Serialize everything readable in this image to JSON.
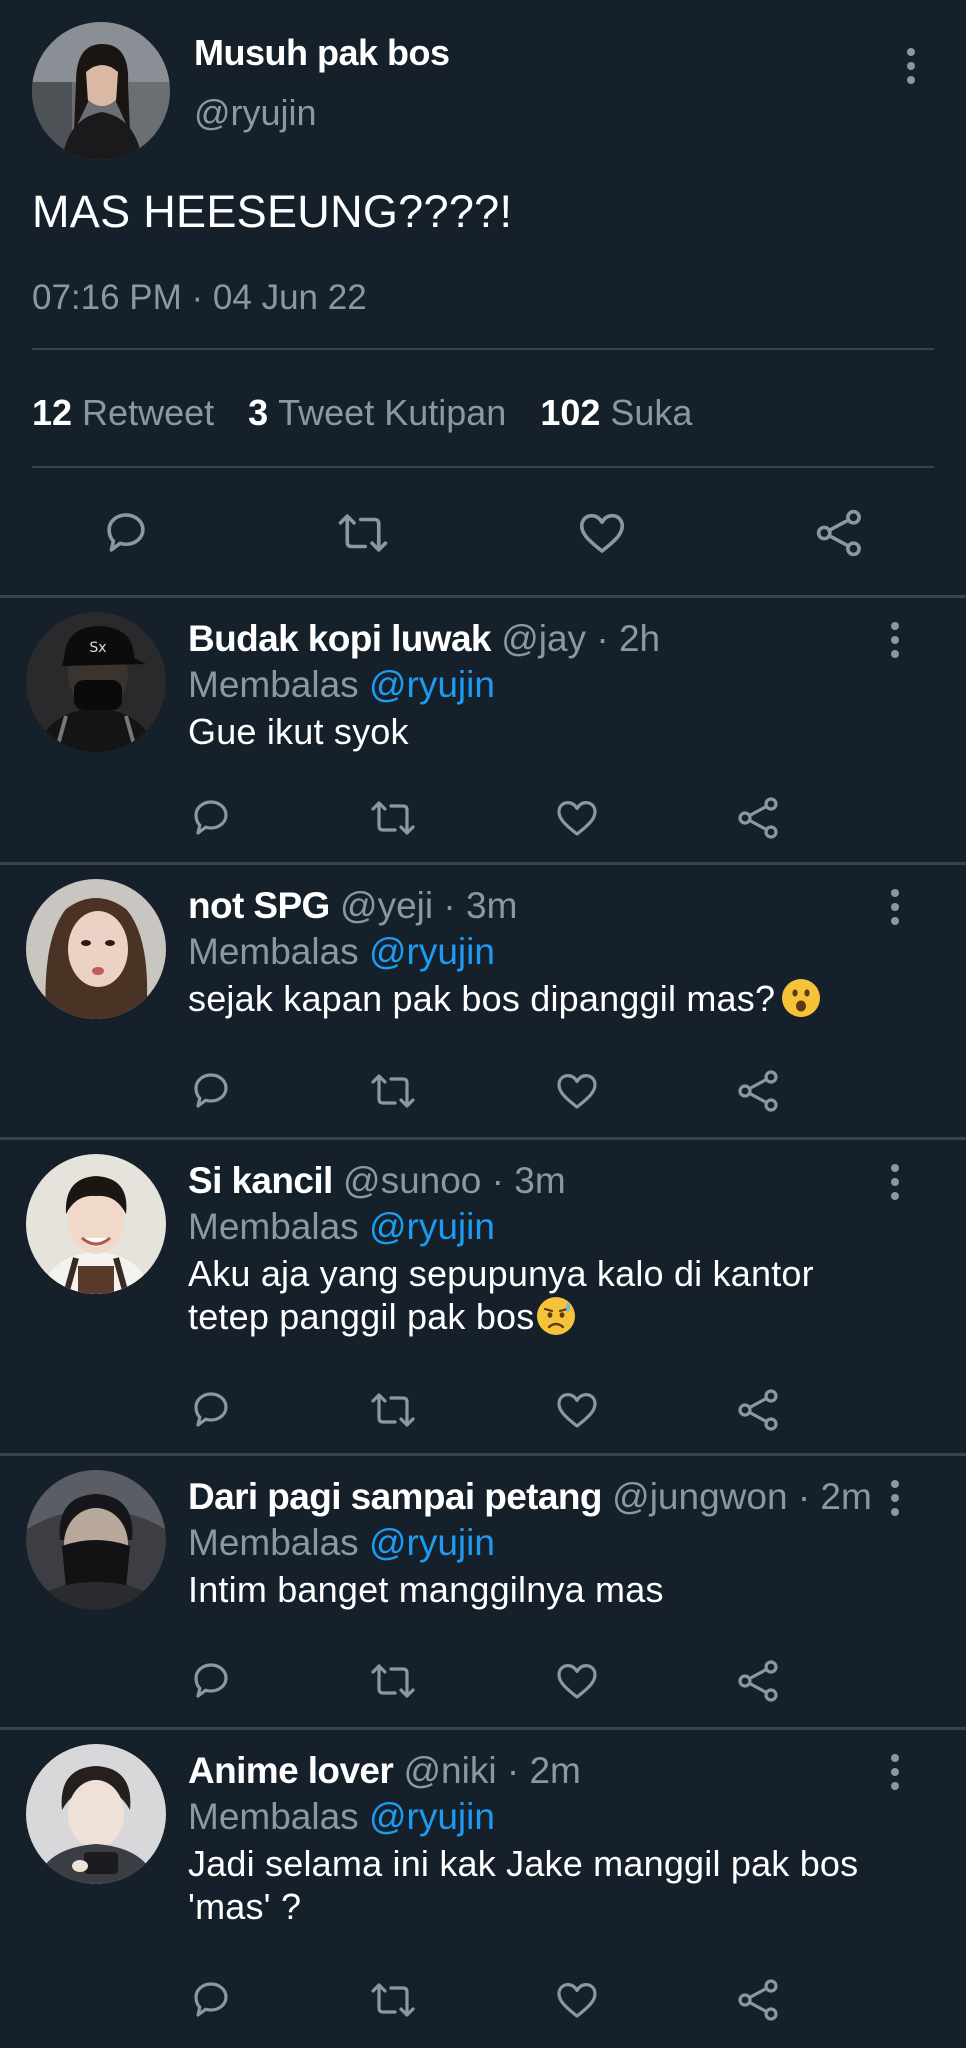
{
  "main_tweet": {
    "display_name": "Musuh pak bos",
    "handle": "@ryujin",
    "text": "MAS HEESEUNG????!",
    "timestamp": "07:16 PM · 04 Jun 22",
    "stats": {
      "retweets_count": "12",
      "retweets_label": "Retweet",
      "quotes_count": "3",
      "quotes_label": "Tweet Kutipan",
      "likes_count": "102",
      "likes_label": "Suka"
    },
    "icons": [
      "reply-icon",
      "retweet-icon",
      "like-icon",
      "share-icon",
      "more-icon"
    ]
  },
  "replies": [
    {
      "display_name": "Budak kopi luwak",
      "meta": "@jay · 2h",
      "replying_prefix": "Membalas",
      "replying_to": "@ryujin",
      "text": "Gue ikut syok"
    },
    {
      "display_name": "not SPG",
      "meta": "@yeji · 3m",
      "replying_prefix": "Membalas",
      "replying_to": "@ryujin",
      "text": "sejak kapan pak bos dipanggil mas?",
      "emoji": "frowning-open-mouth-emoji"
    },
    {
      "display_name": "Si kancil",
      "meta": "@sunoo · 3m",
      "replying_prefix": "Membalas",
      "replying_to": "@ryujin",
      "text_line1": "Aku aja yang sepupunya kalo di kantor",
      "text_line2": "tetep panggil pak bos",
      "emoji": "sad-sweat-emoji"
    },
    {
      "display_name": "Dari pagi sampai petang",
      "meta": "@jungwon · 2m",
      "replying_prefix": "Membalas",
      "replying_to": "@ryujin",
      "text": "Intim banget manggilnya mas"
    },
    {
      "display_name": "Anime lover",
      "meta": "@niki · 2m",
      "replying_prefix": "Membalas",
      "replying_to": "@ryujin",
      "text_line1": "Jadi selama ini kak Jake manggil pak bos",
      "text_line2": "'mas' ?"
    }
  ],
  "colors": {
    "background": "#15202b",
    "divider": "#38444d",
    "secondary_text": "#8899a6",
    "mention": "#1d9bf0",
    "primary_text": "#ffffff"
  }
}
